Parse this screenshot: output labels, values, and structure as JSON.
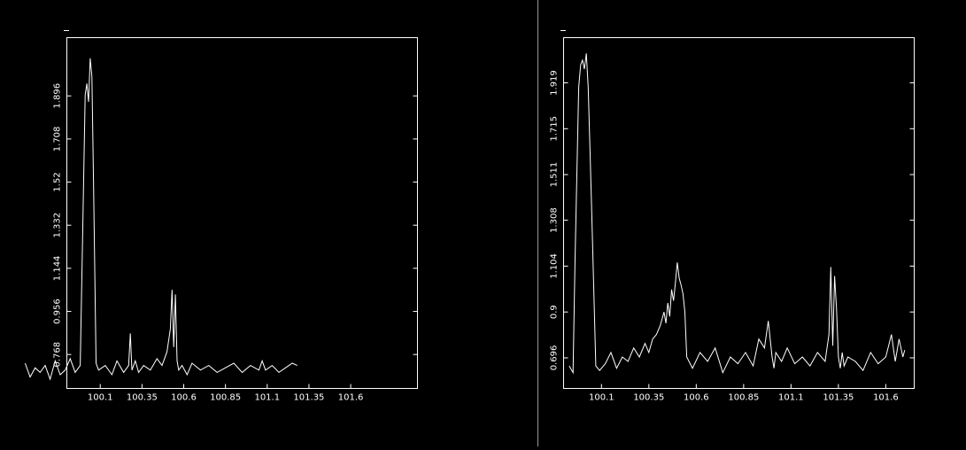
{
  "colors": {
    "background": "#000000",
    "foreground": "#ffffff",
    "divider": "#9a9a9a"
  },
  "chart_data": [
    {
      "type": "line",
      "title": "",
      "xlabel": "",
      "ylabel": "",
      "xlim": [
        99.9,
        102.0
      ],
      "ylim": [
        0.62,
        2.15
      ],
      "x_ticks": [
        100.1,
        100.35,
        100.6,
        100.85,
        101.1,
        101.35,
        101.6
      ],
      "x_tick_labels": [
        "100.1",
        "100.35",
        "100.6",
        "100.85",
        "101.1",
        "101.35",
        "101.6"
      ],
      "y_ticks": [
        0.768,
        0.956,
        1.144,
        1.332,
        1.52,
        1.708,
        1.896
      ],
      "y_tick_labels": [
        "0.768",
        "0.956",
        "1.144",
        "1.332",
        "1.52",
        "1.708",
        "1.896"
      ],
      "grid": false,
      "series": [
        {
          "x": [
            99.65,
            99.68,
            99.71,
            99.74,
            99.77,
            99.8,
            99.83,
            99.86,
            99.89,
            99.92,
            99.95,
            99.98,
            99.995,
            100.01,
            100.02,
            100.03,
            100.04,
            100.05,
            100.06,
            100.075,
            100.09,
            100.13,
            100.17,
            100.2,
            100.24,
            100.27,
            100.28,
            100.29,
            100.31,
            100.33,
            100.36,
            100.4,
            100.44,
            100.47,
            100.5,
            100.52,
            100.53,
            100.54,
            100.55,
            100.56,
            100.57,
            100.59,
            100.62,
            100.65,
            100.7,
            100.75,
            100.8,
            100.85,
            100.9,
            100.95,
            101.0,
            101.05,
            101.07,
            101.09,
            101.13,
            101.17,
            101.21,
            101.25,
            101.28
          ],
          "y": [
            0.73,
            0.67,
            0.71,
            0.69,
            0.72,
            0.66,
            0.74,
            0.68,
            0.7,
            0.75,
            0.69,
            0.72,
            1.3,
            1.9,
            1.95,
            1.87,
            2.06,
            1.98,
            1.5,
            0.73,
            0.7,
            0.72,
            0.68,
            0.74,
            0.69,
            0.72,
            0.86,
            0.7,
            0.74,
            0.69,
            0.72,
            0.7,
            0.75,
            0.72,
            0.78,
            0.88,
            1.05,
            0.8,
            1.03,
            0.74,
            0.7,
            0.72,
            0.68,
            0.73,
            0.7,
            0.72,
            0.69,
            0.71,
            0.73,
            0.69,
            0.72,
            0.7,
            0.74,
            0.7,
            0.72,
            0.69,
            0.71,
            0.73,
            0.72
          ]
        }
      ]
    },
    {
      "type": "line",
      "title": "",
      "xlabel": "",
      "ylabel": "",
      "xlim": [
        99.9,
        101.75
      ],
      "ylim": [
        0.56,
        2.12
      ],
      "x_ticks": [
        100.1,
        100.35,
        100.6,
        100.85,
        101.1,
        101.35,
        101.6
      ],
      "x_tick_labels": [
        "100.1",
        "100.35",
        "100.6",
        "100.85",
        "101.1",
        "101.35",
        "101.6"
      ],
      "y_ticks": [
        0.696,
        0.9,
        1.104,
        1.308,
        1.511,
        1.715,
        1.919
      ],
      "y_tick_labels": [
        "0.696",
        "0.9",
        "1.104",
        "1.308",
        "1.511",
        "1.715",
        "1.919"
      ],
      "grid": false,
      "series": [
        {
          "x": [
            99.93,
            99.95,
            99.96,
            99.98,
            99.99,
            100.0,
            100.01,
            100.02,
            100.03,
            100.04,
            100.05,
            100.07,
            100.09,
            100.12,
            100.15,
            100.18,
            100.21,
            100.24,
            100.27,
            100.3,
            100.33,
            100.35,
            100.37,
            100.39,
            100.41,
            100.43,
            100.44,
            100.45,
            100.46,
            100.47,
            100.48,
            100.49,
            100.5,
            100.51,
            100.52,
            100.53,
            100.54,
            100.55,
            100.58,
            100.62,
            100.66,
            100.7,
            100.74,
            100.78,
            100.82,
            100.86,
            100.9,
            100.93,
            100.96,
            100.98,
            101.0,
            101.01,
            101.02,
            101.05,
            101.08,
            101.12,
            101.16,
            101.2,
            101.24,
            101.28,
            101.3,
            101.31,
            101.32,
            101.33,
            101.34,
            101.35,
            101.36,
            101.37,
            101.38,
            101.4,
            101.44,
            101.48,
            101.52,
            101.56,
            101.6,
            101.63,
            101.65,
            101.67,
            101.69,
            101.7
          ],
          "y": [
            0.66,
            0.63,
            1.1,
            1.9,
            2.0,
            2.02,
            1.98,
            2.05,
            1.9,
            1.6,
            1.3,
            0.66,
            0.64,
            0.67,
            0.72,
            0.65,
            0.7,
            0.68,
            0.74,
            0.7,
            0.76,
            0.72,
            0.78,
            0.8,
            0.84,
            0.9,
            0.85,
            0.94,
            0.88,
            1.0,
            0.95,
            1.03,
            1.12,
            1.05,
            1.02,
            0.98,
            0.9,
            0.7,
            0.65,
            0.72,
            0.68,
            0.74,
            0.63,
            0.7,
            0.67,
            0.72,
            0.66,
            0.78,
            0.74,
            0.86,
            0.7,
            0.65,
            0.72,
            0.68,
            0.74,
            0.67,
            0.7,
            0.66,
            0.72,
            0.68,
            0.8,
            1.1,
            0.75,
            1.06,
            0.92,
            0.7,
            0.65,
            0.72,
            0.66,
            0.7,
            0.68,
            0.64,
            0.72,
            0.67,
            0.7,
            0.8,
            0.68,
            0.78,
            0.7,
            0.73
          ]
        }
      ]
    }
  ]
}
